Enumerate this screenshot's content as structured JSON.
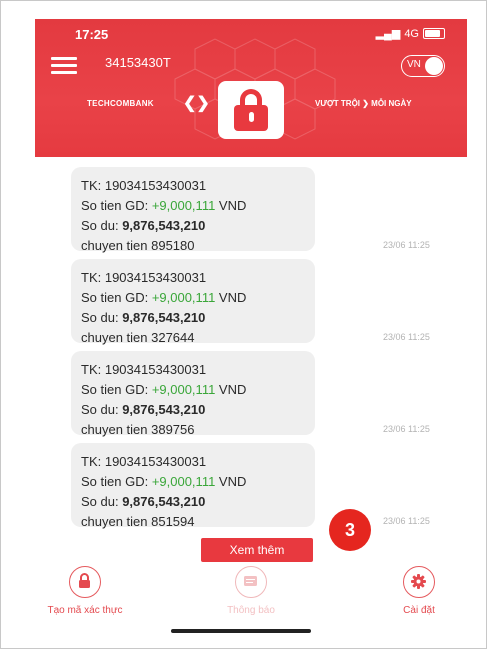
{
  "status": {
    "time": "17:25",
    "network": "4G"
  },
  "header": {
    "account": "34153430T",
    "lang": "VN",
    "bank_name": "TECHCOMBANK",
    "slogan": "VƯỢT TRỘI ❯ MỖI NGÀY"
  },
  "messages": [
    {
      "tk": "TK: 19034153430031",
      "gd_label": "So tien GD: ",
      "gd_amount": "+9,000,111",
      "gd_unit": " VND",
      "du_label": "So du: ",
      "du_amount": "9,876,543,210",
      "note": "chuyen tien 895180",
      "time": "23/06 11:25"
    },
    {
      "tk": "TK: 19034153430031",
      "gd_label": "So tien GD: ",
      "gd_amount": "+9,000,111",
      "gd_unit": " VND",
      "du_label": "So du: ",
      "du_amount": "9,876,543,210",
      "note": "chuyen tien 327644",
      "time": "23/06 11:25"
    },
    {
      "tk": "TK: 19034153430031",
      "gd_label": "So tien GD: ",
      "gd_amount": "+9,000,111",
      "gd_unit": " VND",
      "du_label": "So du: ",
      "du_amount": "9,876,543,210",
      "note": "chuyen tien 389756",
      "time": "23/06 11:25"
    },
    {
      "tk": "TK: 19034153430031",
      "gd_label": "So tien GD: ",
      "gd_amount": "+9,000,111",
      "gd_unit": " VND",
      "du_label": "So du: ",
      "du_amount": "9,876,543,210",
      "note": "chuyen tien 851594",
      "time": "23/06 11:25"
    }
  ],
  "more_button": "Xem thêm",
  "badge": "3",
  "nav": [
    {
      "label": "Tạo mã xác thực",
      "icon": "lock-icon"
    },
    {
      "label": "Thông báo",
      "icon": "message-icon"
    },
    {
      "label": "Cài đặt",
      "icon": "gear-icon"
    }
  ],
  "colors": {
    "brand": "#e8393f",
    "amount": "#3aa639",
    "badge": "#e5261f"
  }
}
